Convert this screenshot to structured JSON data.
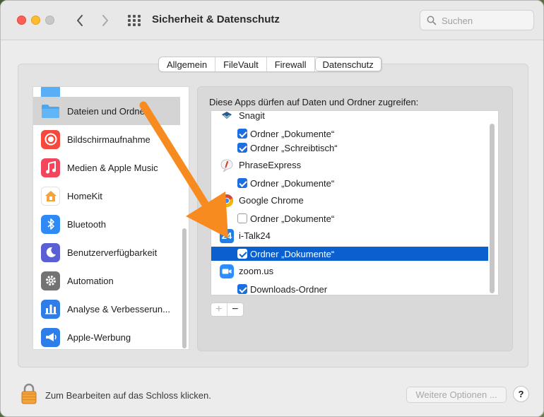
{
  "window": {
    "title": "Sicherheit & Datenschutz"
  },
  "search": {
    "placeholder": "Suchen"
  },
  "tabs": [
    {
      "label": "Allgemein",
      "active": false
    },
    {
      "label": "FileVault",
      "active": false
    },
    {
      "label": "Firewall",
      "active": false
    },
    {
      "label": "Datenschutz",
      "active": true
    }
  ],
  "sidebar": {
    "items": [
      {
        "label": "",
        "icon": "folder-icon",
        "color": "#5aaef5"
      },
      {
        "label": "Dateien und Ordner",
        "icon": "folder-icon",
        "color": "#4ca6ec",
        "selected": true
      },
      {
        "label": "Bildschirmaufnahme",
        "icon": "record-icon",
        "color": "#f5493d"
      },
      {
        "label": "Medien & Apple Music",
        "icon": "music-note-icon",
        "color": "#f3465d"
      },
      {
        "label": "HomeKit",
        "icon": "home-icon",
        "color": "#ffffff"
      },
      {
        "label": "Bluetooth",
        "icon": "bluetooth-icon",
        "color": "#2f8af5"
      },
      {
        "label": "Benutzerverfügbarkeit",
        "icon": "moon-icon",
        "color": "#5a5fd6"
      },
      {
        "label": "Automation",
        "icon": "gear-icon",
        "color": "#737373"
      },
      {
        "label": "Analyse & Verbesserun...",
        "icon": "chart-icon",
        "color": "#2f7de8"
      },
      {
        "label": "Apple-Werbung",
        "icon": "megaphone-icon",
        "color": "#2f7de8"
      }
    ]
  },
  "main": {
    "heading": "Diese Apps dürfen auf Daten und Ordner zugreifen:",
    "apps": [
      {
        "name": "Snagit",
        "icon": "snagit-icon"
      },
      {
        "name": "PhraseExpress",
        "icon": "phraseexpress-icon"
      },
      {
        "name": "Google Chrome",
        "icon": "chrome-icon"
      },
      {
        "name": "i-Talk24",
        "icon": "italk24-icon",
        "icon_text": "24"
      },
      {
        "name": "zoom.us",
        "icon": "zoom-icon"
      }
    ],
    "permissions": {
      "snagit_docs": {
        "label": "Ordner „Dokumente“",
        "checked": true
      },
      "snagit_desk": {
        "label": "Ordner „Schreibtisch“",
        "checked": true
      },
      "phrase_docs": {
        "label": "Ordner „Dokumente“",
        "checked": true
      },
      "chrome_docs": {
        "label": "Ordner „Dokumente“",
        "checked": false
      },
      "italk_docs": {
        "label": "Ordner „Dokumente“",
        "checked": true,
        "selected": true
      },
      "zoom_downloads": {
        "label": "Downloads-Ordner",
        "checked": true
      }
    },
    "add_label": "+",
    "remove_label": "−"
  },
  "footer": {
    "lock_text": "Zum Bearbeiten auf das Schloss klicken.",
    "more_options": "Weitere Optionen ...",
    "help": "?"
  },
  "annotation": {
    "arrow_color": "#f78b1f"
  }
}
